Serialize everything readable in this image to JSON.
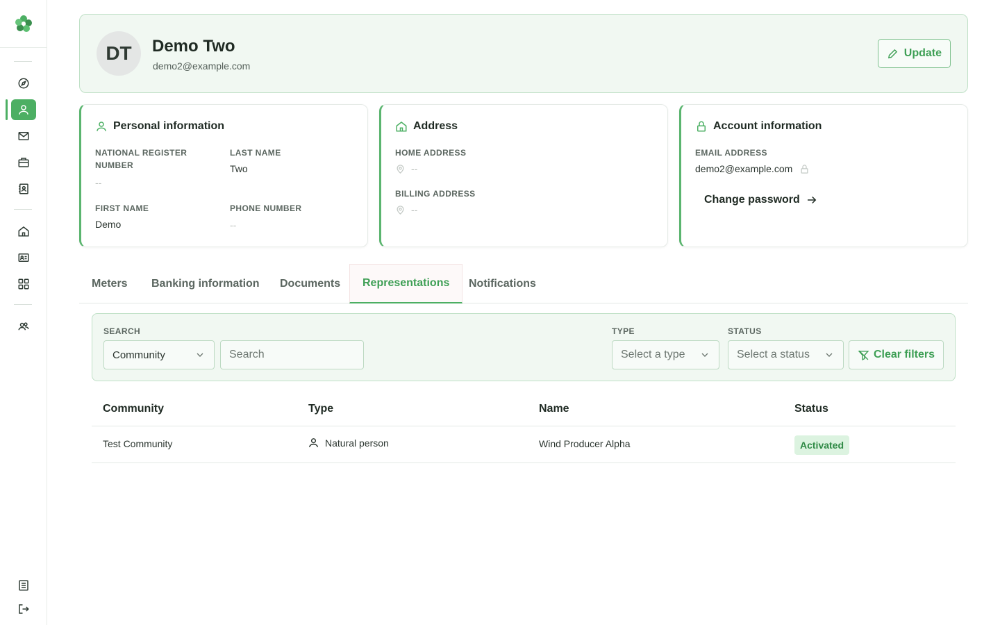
{
  "sidebar": {
    "items": [
      {
        "name": "explore",
        "icon": "compass-icon"
      },
      {
        "name": "profile",
        "icon": "user-icon",
        "active": true
      },
      {
        "name": "messages",
        "icon": "mail-icon"
      },
      {
        "name": "portfolio",
        "icon": "briefcase-icon"
      },
      {
        "name": "contacts",
        "icon": "contact-book-icon"
      },
      {
        "name": "home",
        "icon": "home-icon"
      },
      {
        "name": "id-card",
        "icon": "id-card-icon"
      },
      {
        "name": "apps",
        "icon": "grid-icon"
      },
      {
        "name": "users",
        "icon": "users-icon"
      },
      {
        "name": "docs",
        "icon": "document-icon"
      },
      {
        "name": "logout",
        "icon": "logout-icon"
      }
    ],
    "accent": "#4caf63"
  },
  "header": {
    "initials": "DT",
    "name": "Demo Two",
    "email": "demo2@example.com",
    "update_label": "Update"
  },
  "personal": {
    "title": "Personal information",
    "national_register_label": "NATIONAL REGISTER NUMBER",
    "national_register_value": "--",
    "last_name_label": "LAST NAME",
    "last_name_value": "Two",
    "first_name_label": "FIRST NAME",
    "first_name_value": "Demo",
    "phone_label": "PHONE NUMBER",
    "phone_value": "--"
  },
  "address": {
    "title": "Address",
    "home_label": "HOME ADDRESS",
    "home_value": "--",
    "billing_label": "BILLING ADDRESS",
    "billing_value": "--"
  },
  "account": {
    "title": "Account information",
    "email_label": "EMAIL ADDRESS",
    "email_value": "demo2@example.com",
    "change_password": "Change password"
  },
  "tabs": [
    {
      "label": "Meters"
    },
    {
      "label": "Banking information"
    },
    {
      "label": "Documents"
    },
    {
      "label": "Representations",
      "active": true
    },
    {
      "label": "Notifications"
    }
  ],
  "filters": {
    "search_label": "SEARCH",
    "search_scope": "Community",
    "search_placeholder": "Search",
    "type_label": "TYPE",
    "type_placeholder": "Select a type",
    "status_label": "STATUS",
    "status_placeholder": "Select a status",
    "clear_label": "Clear filters"
  },
  "table": {
    "headers": [
      "Community",
      "Type",
      "Name",
      "Status"
    ],
    "rows": [
      {
        "community": "Test Community",
        "type": "Natural person",
        "name": "Wind Producer Alpha",
        "status": "Activated"
      }
    ]
  }
}
